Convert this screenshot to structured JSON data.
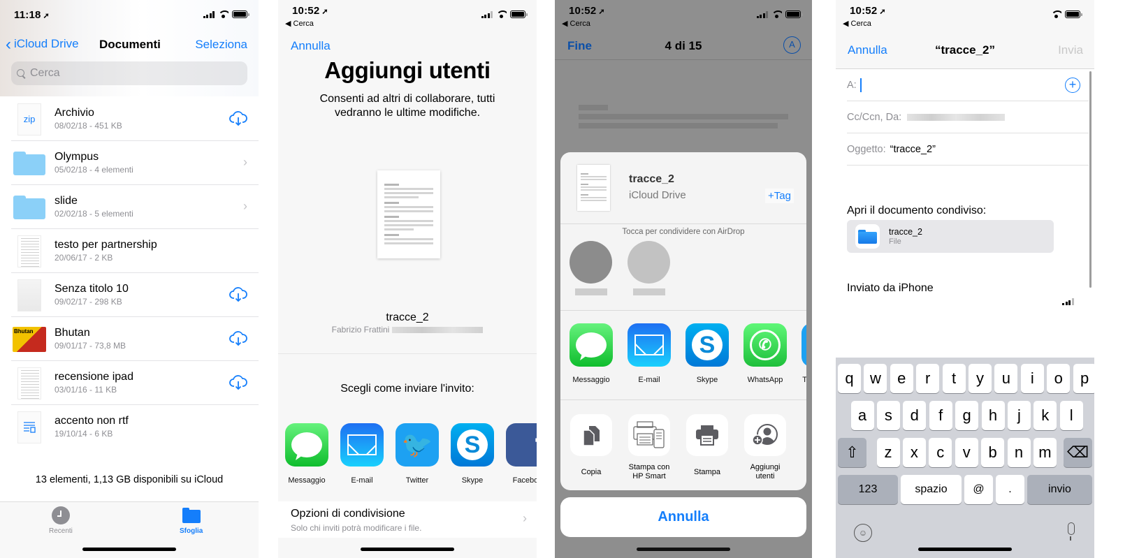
{
  "screens": {
    "files": {
      "status": {
        "time": "11:18"
      },
      "nav": {
        "back_label": "iCloud Drive",
        "title": "Documenti",
        "select_label": "Seleziona"
      },
      "search": {
        "placeholder": "Cerca"
      },
      "items": [
        {
          "name": "Archivio",
          "meta": "08/02/18 - 451 KB",
          "type": "zip",
          "thumb_label": "zip",
          "accessory": "cloud-download"
        },
        {
          "name": "Olympus",
          "meta": "05/02/18 - 4 elementi",
          "type": "folder",
          "accessory": "chevron"
        },
        {
          "name": "slide",
          "meta": "02/02/18 - 5 elementi",
          "type": "folder",
          "accessory": "chevron"
        },
        {
          "name": "testo per partnership",
          "meta": "20/06/17 - 2 KB",
          "type": "document",
          "accessory": "none"
        },
        {
          "name": "Senza titolo 10",
          "meta": "09/02/17 - 298 KB",
          "type": "document",
          "accessory": "cloud-download"
        },
        {
          "name": "Bhutan",
          "meta": "09/01/17 - 73,8 MB",
          "type": "image",
          "thumb_label": "Bhutan",
          "accessory": "cloud-download"
        },
        {
          "name": "recensione ipad",
          "meta": "03/01/16 - 11 KB",
          "type": "document",
          "accessory": "cloud-download"
        },
        {
          "name": "accento non rtf",
          "meta": "19/10/14 - 6 KB",
          "type": "rtf",
          "accessory": "none"
        }
      ],
      "summary": "13 elementi, 1,13 GB disponibili su iCloud",
      "tabs": [
        {
          "label": "Recenti",
          "icon": "clock-icon",
          "active": false
        },
        {
          "label": "Sfoglia",
          "icon": "folder-icon",
          "active": true
        }
      ]
    },
    "add_people": {
      "status": {
        "time": "10:52",
        "back_app": "◀ Cerca"
      },
      "cancel_label": "Annulla",
      "title": "Aggiungi utenti",
      "subtitle": "Consenti ad altri di collaborare, tutti vedranno le ultime modifiche.",
      "document": {
        "name": "tracce_2",
        "owner": "Fabrizio Frattini"
      },
      "choose_label": "Scegli come inviare l'invito:",
      "apps": [
        {
          "label": "Messaggio",
          "icon": "messages-icon"
        },
        {
          "label": "E-mail",
          "icon": "mail-icon"
        },
        {
          "label": "Twitter",
          "icon": "twitter-icon"
        },
        {
          "label": "Skype",
          "icon": "skype-icon"
        },
        {
          "label": "Faceboo",
          "icon": "facebook-icon"
        }
      ],
      "share_options": {
        "title": "Opzioni di condivisione",
        "subtitle": "Solo chi inviti potrà modificare i file."
      }
    },
    "share_sheet": {
      "status": {
        "time": "10:52",
        "back_app": "◀ Cerca"
      },
      "nav": {
        "done_label": "Fine",
        "counter": "4 di 15"
      },
      "file": {
        "name": "tracce_2",
        "location": "iCloud Drive",
        "tag_label": "+Tag"
      },
      "airdrop_hint": "Tocca per condividere con AirDrop",
      "apps": [
        {
          "label": "Messaggio",
          "icon": "messages-icon"
        },
        {
          "label": "E-mail",
          "icon": "mail-icon"
        },
        {
          "label": "Skype",
          "icon": "skype-icon"
        },
        {
          "label": "WhatsApp",
          "icon": "whatsapp-icon"
        },
        {
          "label": "Te",
          "icon": "telegram-icon"
        }
      ],
      "actions": [
        {
          "label": "Copia",
          "icon": "copy-icon"
        },
        {
          "label": "Stampa con\nHP Smart",
          "icon": "hp-print-icon"
        },
        {
          "label": "Stampa",
          "icon": "printer-icon"
        },
        {
          "label": "Aggiungi\nutenti",
          "icon": "add-people-icon"
        }
      ],
      "cancel_label": "Annulla"
    },
    "mail": {
      "status": {
        "time": "10:52",
        "back_app": "◀ Cerca"
      },
      "nav": {
        "cancel_label": "Annulla",
        "title": "“tracce_2”",
        "send_label": "Invia"
      },
      "to_label": "A:",
      "cc_label": "Cc/Ccn, Da:",
      "subject_label": "Oggetto:",
      "subject_value": "“tracce_2”",
      "open_label": "Apri il documento condiviso:",
      "attachment": {
        "name": "tracce_2",
        "type": "File"
      },
      "signature": "Inviato da iPhone",
      "keyboard": {
        "row1": [
          "q",
          "w",
          "e",
          "r",
          "t",
          "y",
          "u",
          "i",
          "o",
          "p"
        ],
        "row2": [
          "a",
          "s",
          "d",
          "f",
          "g",
          "h",
          "j",
          "k",
          "l"
        ],
        "row3": [
          "z",
          "x",
          "c",
          "v",
          "b",
          "n",
          "m"
        ],
        "numbers": "123",
        "space": "spazio",
        "at": "@",
        "dot": ".",
        "return": "invio"
      }
    }
  },
  "colors": {
    "accent": "#147efb",
    "folder": "#8bd0f8",
    "keyboard_bg": "#d1d3d9"
  }
}
